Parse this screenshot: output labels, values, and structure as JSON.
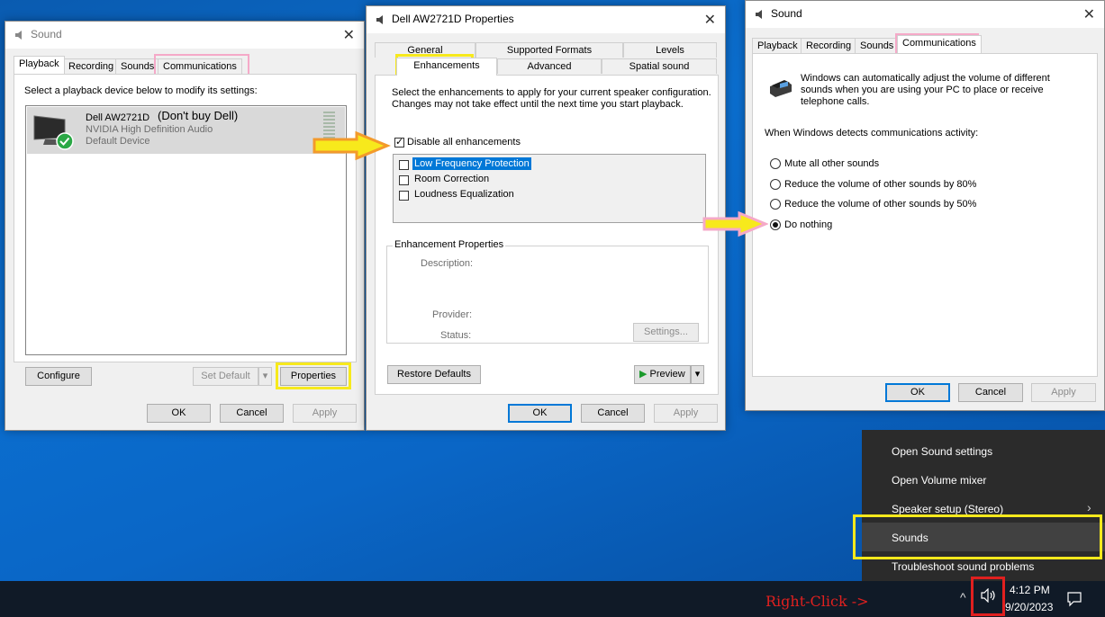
{
  "left_window": {
    "title": "Sound",
    "tabs": [
      "Playback",
      "Recording",
      "Sounds",
      "Communications"
    ],
    "instruction": "Select a playback device below to modify its settings:",
    "device": {
      "name": "Dell AW2721D",
      "note": "(Don't buy Dell)",
      "driver": "NVIDIA High Definition Audio",
      "status": "Default Device"
    },
    "buttons": {
      "configure": "Configure",
      "set_default": "Set Default",
      "properties": "Properties",
      "ok": "OK",
      "cancel": "Cancel",
      "apply": "Apply"
    }
  },
  "middle_window": {
    "title": "Dell AW2721D Properties",
    "tabs_row1": [
      "General",
      "Supported Formats",
      "Levels"
    ],
    "tabs_row2": [
      "Enhancements",
      "Advanced",
      "Spatial sound"
    ],
    "instruction": "Select the enhancements to apply for your current speaker configuration. Changes may not take effect until the next time you start playback.",
    "disable_all": {
      "label": "Disable all enhancements",
      "checked": true
    },
    "enhancements": [
      {
        "label": "Low Frequency Protection",
        "checked": false,
        "selected": true
      },
      {
        "label": "Room Correction",
        "checked": false,
        "selected": false
      },
      {
        "label": "Loudness Equalization",
        "checked": false,
        "selected": false
      }
    ],
    "properties_group": {
      "title": "Enhancement Properties",
      "description_label": "Description:",
      "provider_label": "Provider:",
      "status_label": "Status:",
      "settings_button": "Settings..."
    },
    "buttons": {
      "restore_defaults": "Restore Defaults",
      "preview": "Preview",
      "ok": "OK",
      "cancel": "Cancel",
      "apply": "Apply"
    }
  },
  "right_window": {
    "title": "Sound",
    "tabs": [
      "Playback",
      "Recording",
      "Sounds",
      "Communications"
    ],
    "info": "Windows can automatically adjust the volume of different sounds when you are using your PC to place or receive telephone calls.",
    "prompt": "When Windows detects communications activity:",
    "options": [
      {
        "label": "Mute all other sounds",
        "selected": false
      },
      {
        "label": "Reduce the volume of other sounds by 80%",
        "selected": false
      },
      {
        "label": "Reduce the volume of other sounds by 50%",
        "selected": false
      },
      {
        "label": "Do nothing",
        "selected": true
      }
    ],
    "buttons": {
      "ok": "OK",
      "cancel": "Cancel",
      "apply": "Apply"
    }
  },
  "context_menu": {
    "items": [
      "Open Sound settings",
      "Open Volume mixer",
      "Speaker setup (Stereo)",
      "Sounds",
      "Troubleshoot sound problems"
    ]
  },
  "taskbar": {
    "annotation": "Right-Click ->",
    "time": "4:12 PM",
    "date": "9/20/2023"
  },
  "colors": {
    "highlight_yellow": "#f7e91c",
    "highlight_pink": "#f5a9c8",
    "arrow_orange": "#f39a2b",
    "annotation_red": "#e0201f",
    "selection_blue": "#0078d7"
  }
}
